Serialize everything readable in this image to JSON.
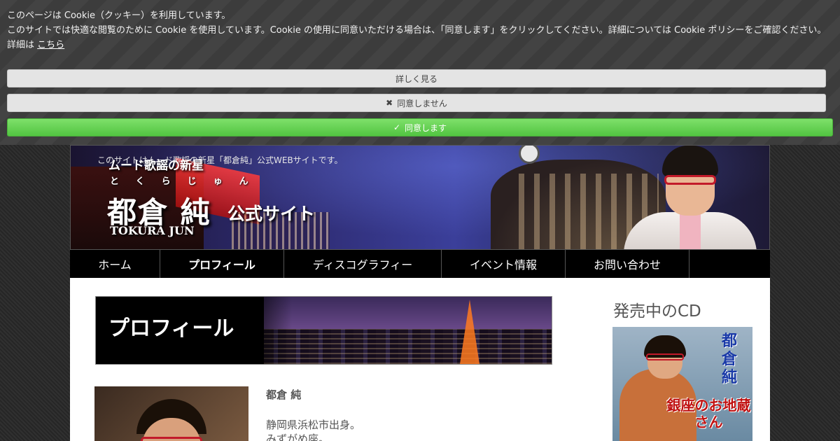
{
  "cookie": {
    "line1": "このページは Cookie（クッキー）を利用しています。",
    "line2": "このサイトでは快適な閲覧のために Cookie を使用しています。Cookie の使用に同意いただける場合は、「同意します」をクリックしてください。詳細については Cookie ポリシーをご確認ください。",
    "details_prefix": "詳細は",
    "details_link": "こちら",
    "btn_details": "詳しく見る",
    "btn_decline": "同意しません",
    "btn_accept": "同意します",
    "decline_icon": "close-icon",
    "accept_icon": "check-icon"
  },
  "header": {
    "tagline": "このサイトはムード歌謡の新星「都倉純」公式WEBサイトです。",
    "subtitle": "ムード歌謡の新星",
    "ruby": "とくらじゅん",
    "name": "都倉 純",
    "official": "公式サイト",
    "roman": "TOKURA JUN"
  },
  "nav": {
    "items": [
      {
        "label": "ホーム"
      },
      {
        "label": "プロフィール"
      },
      {
        "label": "ディスコグラフィー"
      },
      {
        "label": "イベント情報"
      },
      {
        "label": "お問い合わせ"
      }
    ]
  },
  "content": {
    "banner_title": "プロフィール",
    "profile_name": "都倉 純",
    "profile_lines": [
      "静岡県浜松市出身。",
      "みずがめ座。"
    ]
  },
  "sidebar": {
    "title": "発売中のCD",
    "cd_artist": "都倉純",
    "cd_song": "銀座のお地蔵さん"
  },
  "colors": {
    "accept": "#52c441",
    "nav_bg": "#000000",
    "glasses": "#c21a2a"
  }
}
